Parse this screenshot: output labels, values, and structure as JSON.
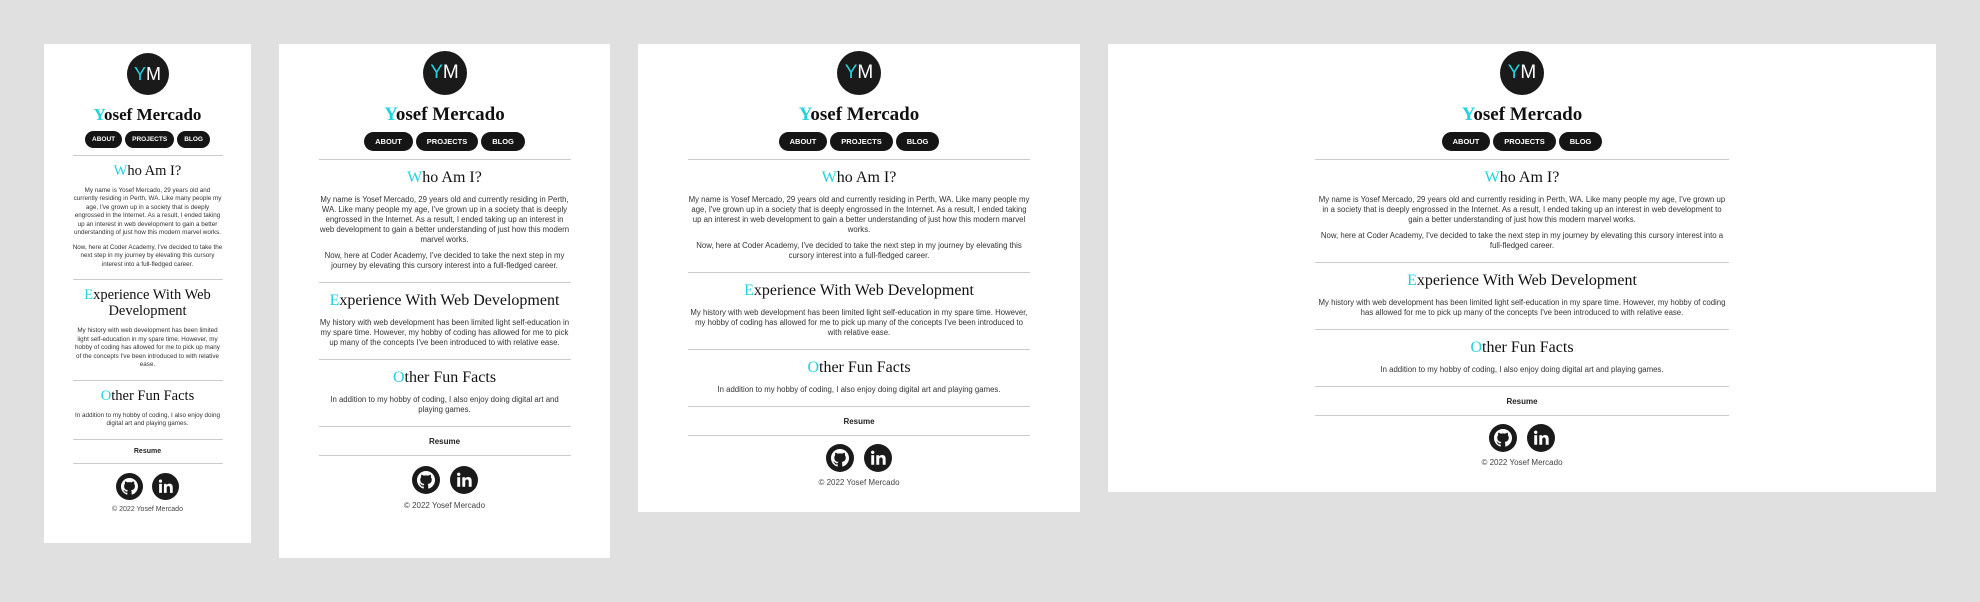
{
  "site": {
    "logo": {
      "letter1": "Y",
      "letter2": "M"
    },
    "name": {
      "first_letter": "Y",
      "rest": "osef Mercado"
    },
    "nav": [
      "ABOUT",
      "PROJECTS",
      "BLOG"
    ],
    "sections": [
      {
        "title_initial": "W",
        "title_rest": "ho Am I?",
        "paragraphs": [
          "My name is Yosef Mercado, 29 years old and currently residing in Perth, WA. Like many people my age, I've grown up in a society that is deeply engrossed in the Internet. As a result, I ended taking up an interest in web development to gain a better understanding of just how this modern marvel works.",
          "Now, here at Coder Academy, I've decided to take the next step in my journey by elevating this cursory interest into a full-fledged career."
        ]
      },
      {
        "title_initial": "E",
        "title_rest": "xperience With Web Development",
        "paragraphs": [
          "My history with web development has been limited light self-education in my spare time. However, my hobby of coding has allowed for me to pick up many of the concepts I've been introduced to with relative ease."
        ]
      },
      {
        "title_initial": "O",
        "title_rest": "ther Fun Facts",
        "paragraphs": [
          "In addition to my hobby of coding, I also enjoy doing digital art and playing games."
        ]
      }
    ],
    "resume_label": "Resume",
    "social_icons": [
      "github-icon",
      "linkedin-icon"
    ],
    "copyright": "© 2022 Yosef Mercado"
  },
  "colors": {
    "background": "#e0e0e0",
    "page": "#ffffff",
    "accent": "#22d3e0",
    "dark": "#151515"
  }
}
